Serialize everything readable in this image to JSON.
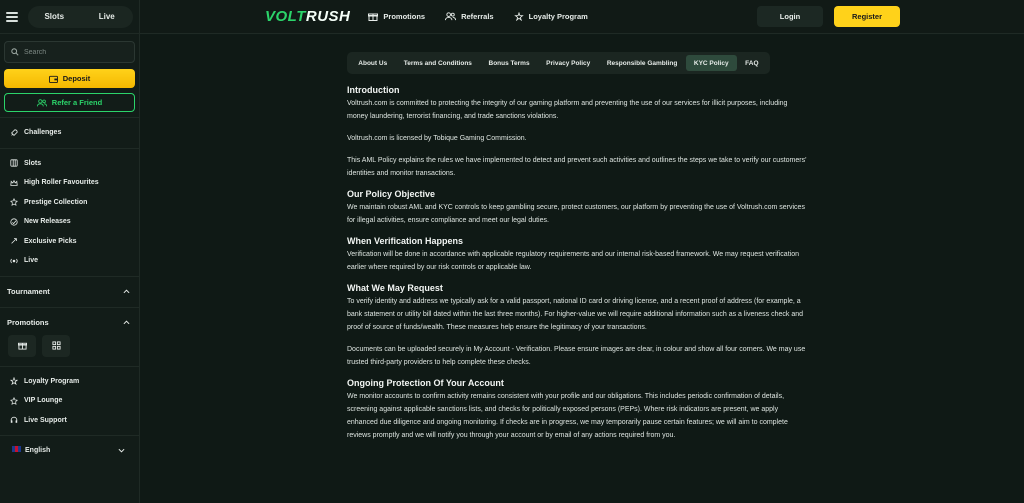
{
  "app": {
    "logo_part1": "VOLT",
    "logo_part2": "RUSH"
  },
  "colors": {
    "accent_green": "#2bd46a",
    "accent_yellow": "#ffd21a",
    "background": "#0f1a16"
  },
  "sidebar": {
    "toggle": {
      "left": "Slots",
      "right": "Live"
    },
    "search_placeholder": "Search",
    "deposit_label": "Deposit",
    "refer_label": "Refer a Friend",
    "challenges": "Challenges",
    "items": [
      {
        "label": "Slots",
        "icon": "slots-icon"
      },
      {
        "label": "High Roller Favourites",
        "icon": "crown-icon"
      },
      {
        "label": "Prestige Collection",
        "icon": "star-icon"
      },
      {
        "label": "New Releases",
        "icon": "new-icon"
      },
      {
        "label": "Exclusive Picks",
        "icon": "pick-icon"
      },
      {
        "label": "Live",
        "icon": "live-icon"
      }
    ],
    "tournament": "Tournament",
    "promotions": "Promotions",
    "bottom_items": [
      {
        "label": "Loyalty Program",
        "icon": "loyalty-icon"
      },
      {
        "label": "VIP Lounge",
        "icon": "vip-icon"
      },
      {
        "label": "Live Support",
        "icon": "headset-icon"
      }
    ],
    "language": "English"
  },
  "header": {
    "nav": [
      {
        "label": "Promotions",
        "icon": "promotions-icon"
      },
      {
        "label": "Referrals",
        "icon": "referrals-icon"
      },
      {
        "label": "Loyalty Program",
        "icon": "loyalty-icon"
      }
    ],
    "login": "Login",
    "register": "Register"
  },
  "tabs": [
    {
      "label": "About Us"
    },
    {
      "label": "Terms and Conditions"
    },
    {
      "label": "Bonus Terms"
    },
    {
      "label": "Privacy Policy"
    },
    {
      "label": "Responsible Gambling"
    },
    {
      "label": "KYC Policy",
      "active": true
    },
    {
      "label": "FAQ"
    }
  ],
  "content": {
    "intro_title": "Introduction",
    "intro_p1": "Voltrush.com is committed to protecting the integrity of our gaming platform and preventing the use of our services for illicit purposes, including money laundering, terrorist financing, and trade sanctions violations.",
    "intro_p2": "Voltrush.com is licensed by Tobique Gaming Commission.",
    "intro_p3": "This AML Policy explains the rules we have implemented to detect and prevent such activities and outlines the steps we take to verify our customers' identities and monitor transactions.",
    "objective_title": "Our Policy Objective",
    "objective_p": "We maintain robust AML and KYC controls to keep gambling secure, protect customers, our platform by preventing the use of Voltrush.com services for illegal activities, ensure compliance and meet our legal duties.",
    "verification_title": "When Verification Happens",
    "verification_p": "Verification will be done in accordance with applicable regulatory requirements and our internal risk-based framework. We may request verification earlier where required by our risk controls or applicable law.",
    "request_title": "What We May Request",
    "request_p1": "To verify identity and address we typically ask for a valid passport, national ID card or driving license, and a recent proof of address (for example, a bank statement or utility bill dated within the last three months). For higher-value we will require additional information such as a liveness check and proof of source of funds/wealth. These measures help ensure the legitimacy of your transactions.",
    "request_p2": "Documents can be uploaded securely in My Account - Verification. Please ensure images are clear, in colour and show all four corners. We may use trusted third-party providers to help complete these checks.",
    "ongoing_title": "Ongoing Protection Of Your Account",
    "ongoing_p": "We monitor accounts to confirm activity remains consistent with your profile and our obligations. This includes periodic confirmation of details, screening against applicable sanctions lists, and checks for politically exposed persons (PEPs). Where risk indicators are present, we apply enhanced due diligence and ongoing monitoring. If checks are in progress, we may temporarily pause certain features; we will aim to complete reviews promptly and we will notify you through your account or by email of any actions required from you."
  }
}
